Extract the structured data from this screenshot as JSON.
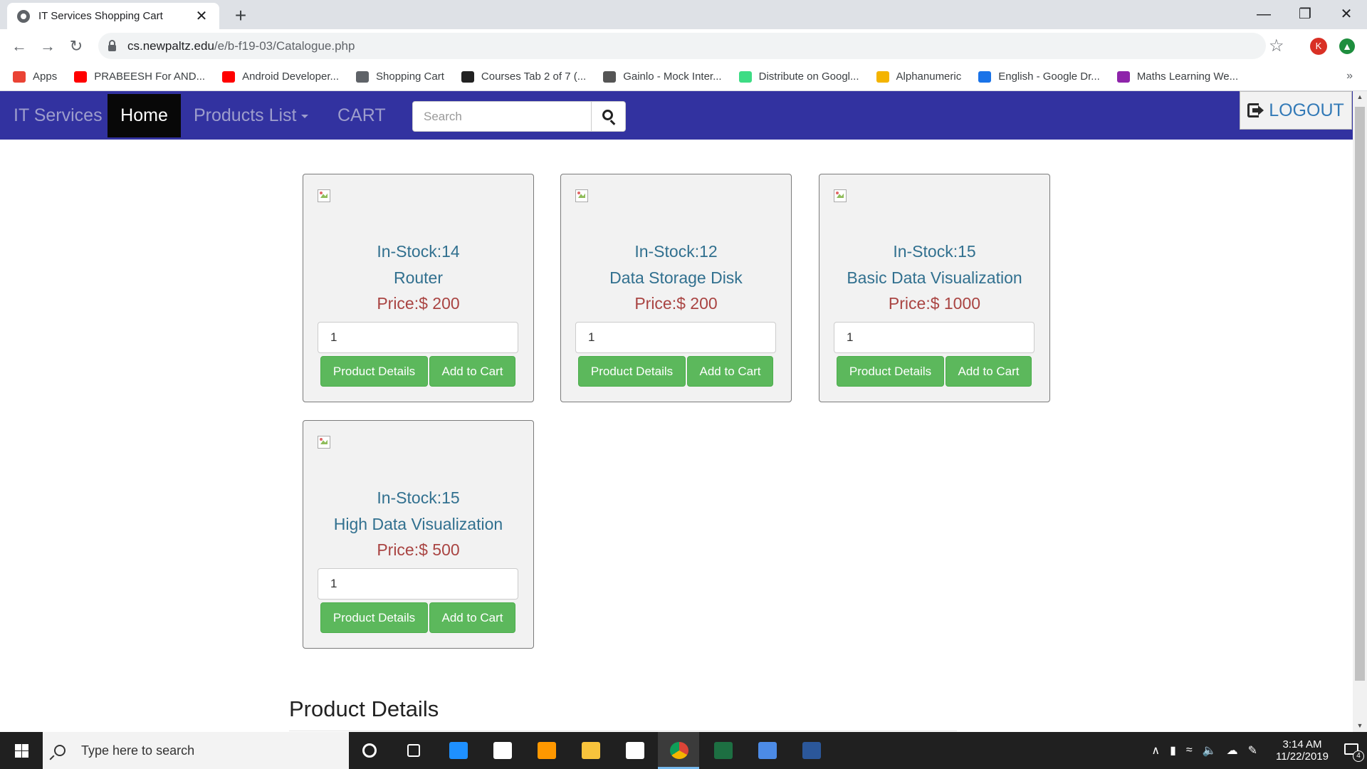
{
  "browser": {
    "tab_title": "IT Services Shopping Cart",
    "tab_close": "✕",
    "new_tab": "+",
    "url_host": "cs.newpaltz.edu",
    "url_path": "/e/b-f19-03/Catalogue.php",
    "profile_initial": "K",
    "bookmarks": [
      {
        "label": "Apps",
        "color": "#ea4335"
      },
      {
        "label": "PRABEESH For AND...",
        "color": "#ff0000"
      },
      {
        "label": "Android Developer...",
        "color": "#ff0000"
      },
      {
        "label": "Shopping Cart",
        "color": "#5f6368"
      },
      {
        "label": "Courses Tab 2 of 7 (...",
        "color": "#222222"
      },
      {
        "label": "Gainlo - Mock Inter...",
        "color": "#555555"
      },
      {
        "label": "Distribute on Googl...",
        "color": "#3ddc84"
      },
      {
        "label": "Alphanumeric",
        "color": "#f4b400"
      },
      {
        "label": "English - Google Dr...",
        "color": "#1a73e8"
      },
      {
        "label": "Maths Learning We...",
        "color": "#8e24aa"
      }
    ],
    "bookmarks_more": "»"
  },
  "navbar": {
    "brand": "IT Services",
    "home": "Home",
    "products": "Products List",
    "cart": "CART",
    "search_placeholder": "Search",
    "logout": "LOGOUT"
  },
  "products": [
    {
      "stock": "In-Stock:14",
      "name": "Router",
      "price": "Price:$ 200",
      "qty": "1",
      "details_label": "Product Details",
      "add_label": "Add to Cart"
    },
    {
      "stock": "In-Stock:12",
      "name": "Data Storage Disk",
      "price": "Price:$ 200",
      "qty": "1",
      "details_label": "Product Details",
      "add_label": "Add to Cart"
    },
    {
      "stock": "In-Stock:15",
      "name": "Basic Data Visualization",
      "price": "Price:$ 1000",
      "qty": "1",
      "details_label": "Product Details",
      "add_label": "Add to Cart"
    },
    {
      "stock": "In-Stock:15",
      "name": "High Data Visualization",
      "price": "Price:$ 500",
      "qty": "1",
      "details_label": "Product Details",
      "add_label": "Add to Cart"
    }
  ],
  "details_heading": "Product Details",
  "taskbar": {
    "search_placeholder": "Type here to search",
    "time": "3:14 AM",
    "date": "11/22/2019",
    "notification_count": "4",
    "apps": [
      {
        "name": "cortana",
        "color": "#ffffff"
      },
      {
        "name": "task-view",
        "color": "#ffffff"
      },
      {
        "name": "edge",
        "color": "#1e90ff"
      },
      {
        "name": "mail",
        "color": "#ffffff"
      },
      {
        "name": "sublime",
        "color": "#ff9800"
      },
      {
        "name": "file-explorer",
        "color": "#f8c33c"
      },
      {
        "name": "store",
        "color": "#ffffff"
      },
      {
        "name": "chrome",
        "color": "#db4437"
      },
      {
        "name": "excel",
        "color": "#1d6f42"
      },
      {
        "name": "network",
        "color": "#4c8be6"
      },
      {
        "name": "word",
        "color": "#2b579a"
      }
    ]
  },
  "colors": {
    "navbar_bg": "#3232a0",
    "button_green": "#5cb85c",
    "stock_text": "#31708f",
    "price_text": "#a94442"
  }
}
